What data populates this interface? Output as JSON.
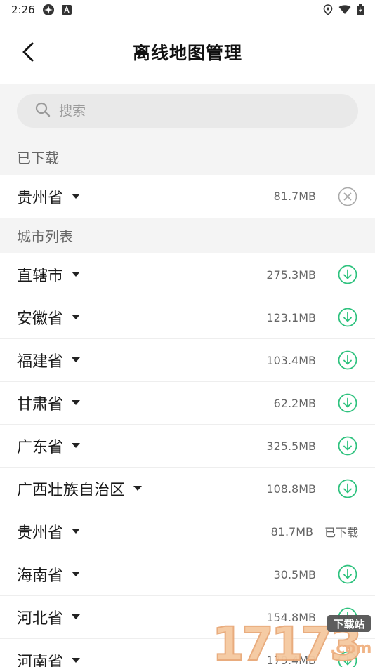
{
  "status_bar": {
    "time": "2:26"
  },
  "header": {
    "title": "离线地图管理",
    "back_icon": "back-arrow-icon"
  },
  "search": {
    "placeholder": "搜索"
  },
  "downloaded_section": {
    "title": "已下载",
    "items": [
      {
        "name": "贵州省",
        "size": "81.7MB",
        "action": "delete"
      }
    ]
  },
  "city_section": {
    "title": "城市列表",
    "items": [
      {
        "name": "直辖市",
        "size": "275.3MB",
        "action": "download"
      },
      {
        "name": "安徽省",
        "size": "123.1MB",
        "action": "download"
      },
      {
        "name": "福建省",
        "size": "103.4MB",
        "action": "download"
      },
      {
        "name": "甘肃省",
        "size": "62.2MB",
        "action": "download"
      },
      {
        "name": "广东省",
        "size": "325.5MB",
        "action": "download"
      },
      {
        "name": "广西壮族自治区",
        "size": "108.8MB",
        "action": "download"
      },
      {
        "name": "贵州省",
        "size": "81.7MB",
        "action": "status",
        "status": "已下载"
      },
      {
        "name": "海南省",
        "size": "30.5MB",
        "action": "download"
      },
      {
        "name": "河北省",
        "size": "154.8MB",
        "action": "download"
      },
      {
        "name": "河南省",
        "size": "179.4MB",
        "action": "download"
      }
    ]
  },
  "watermark": {
    "number": "17173",
    "tag": "下载站",
    "domain": ".com"
  },
  "colors": {
    "accent": "#2ec27e",
    "delete_icon": "#aaaaaa",
    "section_bg": "#f4f4f4"
  }
}
